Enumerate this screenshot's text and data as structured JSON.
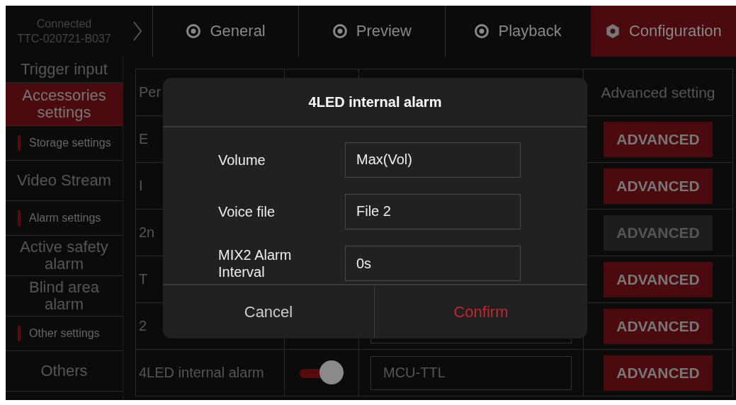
{
  "device": {
    "status": "Connected",
    "id": "TTC-020721-B037"
  },
  "tabs": [
    {
      "label": "General",
      "kind": "radio",
      "selected": false
    },
    {
      "label": "Preview",
      "kind": "radio",
      "selected": false
    },
    {
      "label": "Playback",
      "kind": "radio",
      "selected": false
    },
    {
      "label": "Configuration",
      "kind": "gear",
      "selected": true
    }
  ],
  "sidebar": {
    "items": [
      {
        "kind": "item",
        "label": "Trigger input",
        "selected": false
      },
      {
        "kind": "item",
        "label": "Accessories settings",
        "selected": true
      },
      {
        "kind": "section",
        "label": "Storage settings"
      },
      {
        "kind": "item",
        "label": "Video Stream",
        "selected": false
      },
      {
        "kind": "section",
        "label": "Alarm settings"
      },
      {
        "kind": "item",
        "label": "Active safety alarm",
        "selected": false
      },
      {
        "kind": "item",
        "label": "Blind area alarm",
        "selected": false
      },
      {
        "kind": "section",
        "label": "Other settings"
      },
      {
        "kind": "item",
        "label": "Others",
        "selected": false
      }
    ]
  },
  "table": {
    "header": {
      "column_1": "Per",
      "column_4": "Advanced setting"
    },
    "rows": [
      {
        "column_1": "E",
        "advanced": {
          "label": "ADVANCED",
          "disabled": false
        }
      },
      {
        "column_1": "I",
        "advanced": {
          "label": "ADVANCED",
          "disabled": false
        }
      },
      {
        "column_1": "2n",
        "advanced": {
          "label": "ADVANCED",
          "disabled": true
        }
      },
      {
        "column_1": "T",
        "advanced": {
          "label": "ADVANCED",
          "disabled": false
        }
      },
      {
        "column_1": "2",
        "field_visible": true,
        "advanced": {
          "label": "ADVANCED",
          "disabled": false
        }
      },
      {
        "column_1": "4LED internal alarm",
        "toggle": {
          "on": true
        },
        "field": {
          "value": "MCU-TTL"
        },
        "advanced": {
          "label": "ADVANCED",
          "disabled": false
        }
      }
    ]
  },
  "dialog": {
    "title": "4LED internal alarm",
    "fields": [
      {
        "label": "Volume",
        "value": "Max(Vol)"
      },
      {
        "label": "Voice file",
        "value": "File 2"
      },
      {
        "label": "MIX2 Alarm Interval",
        "value": "0s"
      }
    ],
    "buttons": [
      {
        "label": "Cancel",
        "kind": "cancel"
      },
      {
        "label": "Confirm",
        "kind": "confirm"
      }
    ]
  }
}
